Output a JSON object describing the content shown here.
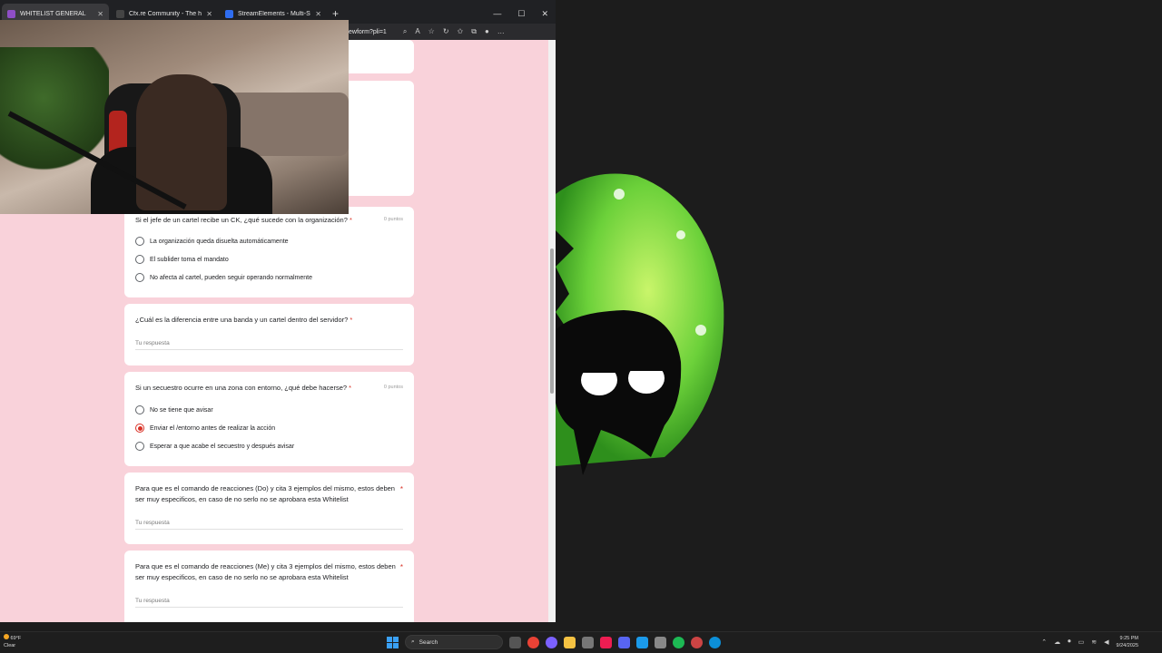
{
  "tabs": [
    {
      "title": "WHITELIST GENERAL",
      "color": "#8e4ec6",
      "active": true
    },
    {
      "title": "Cfx.re Community - The home of",
      "color": "#444444",
      "active": false
    },
    {
      "title": "StreamElements - Multi-Streamin",
      "color": "#2f6df0",
      "active": false
    }
  ],
  "tab_close": "✕",
  "new_tab": "+",
  "window": {
    "minimize": "—",
    "maximize": "☐",
    "close": "✕"
  },
  "address": {
    "url": "ewform?pli=1"
  },
  "questions": {
    "q1": {
      "title": "Si el jefe de un cartel recibe un CK, ¿qué sucede con la organización?",
      "required": "*",
      "points": "0 puntos",
      "options": [
        {
          "label": "La organización queda disuelta automáticamente",
          "selected": false
        },
        {
          "label": "El sublider toma el mandato",
          "selected": false
        },
        {
          "label": "No afecta al cartel, pueden seguir operando normalmente",
          "selected": false
        }
      ]
    },
    "q2": {
      "title": "¿Cuál es la diferencia entre una banda y un cartel dentro del servidor?",
      "required": "*",
      "answer_placeholder": "Tu respuesta"
    },
    "q3": {
      "title": "Si un secuestro ocurre en una zona con entorno, ¿qué debe hacerse?",
      "required": "*",
      "points": "0 puntos",
      "options": [
        {
          "label": "No se tiene que avisar",
          "selected": false
        },
        {
          "label": "Enviar el /entorno antes de realizar la acción",
          "selected": true
        },
        {
          "label": "Esperar a que acabe el secuestro y después avisar",
          "selected": false
        }
      ]
    },
    "q4": {
      "title": "Para que es el comando de reacciones (Do) y cita 3 ejemplos del mismo, estos deben ser muy especificos, en caso de no serlo no se aprobara esta Whitelist",
      "required": "*",
      "answer_placeholder": "Tu respuesta"
    },
    "q5": {
      "title": "Para que es el comando de reacciones (Me) y cita 3 ejemplos del mismo, estos deben ser muy especificos, en caso de no serlo no se aprobara esta Whitelist",
      "required": "*",
      "answer_placeholder": "Tu respuesta"
    }
  },
  "taskbar": {
    "weather_temp": "69°F",
    "weather_desc": "Clear",
    "search_label": "Search",
    "time": "9:25 PM",
    "date": "9/24/2025"
  },
  "colors": {
    "accent": "#d93025",
    "form_bg": "#f9d2da"
  }
}
